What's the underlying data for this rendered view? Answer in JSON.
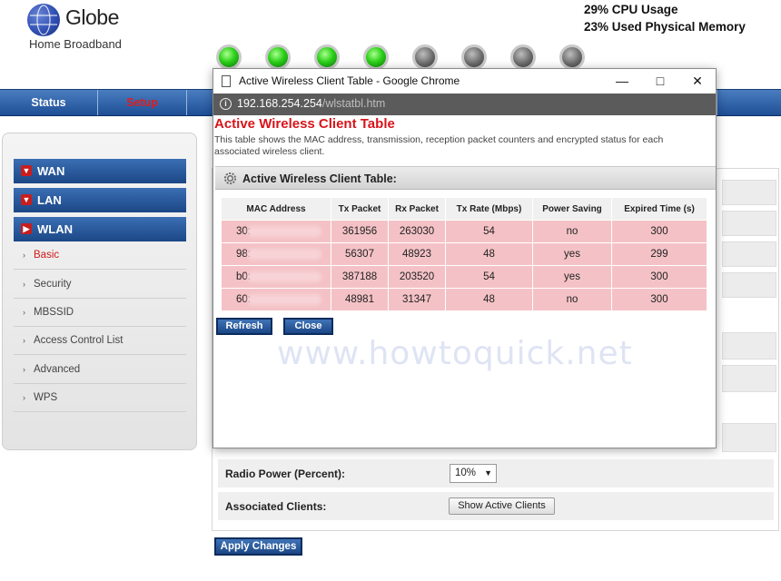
{
  "header": {
    "brand": "Globe",
    "brand_sub": "Home Broadband",
    "cpu_usage": "29% CPU Usage",
    "memory_usage": "23% Used Physical Memory",
    "leds": [
      {
        "state": "on"
      },
      {
        "state": "on"
      },
      {
        "state": "on"
      },
      {
        "state": "on"
      },
      {
        "state": "off"
      },
      {
        "state": "off"
      },
      {
        "state": "off"
      },
      {
        "state": "off"
      }
    ]
  },
  "nav": {
    "tabs": [
      "Status",
      "Setup"
    ],
    "active_tab": "Setup"
  },
  "sidebar": {
    "sections": [
      {
        "label": "WAN"
      },
      {
        "label": "LAN"
      },
      {
        "label": "WLAN"
      }
    ],
    "wlan_items": [
      {
        "label": "Basic",
        "active": true
      },
      {
        "label": "Security"
      },
      {
        "label": "MBSSID"
      },
      {
        "label": "Access Control List"
      },
      {
        "label": "Advanced"
      },
      {
        "label": "WPS"
      }
    ]
  },
  "main": {
    "radio_power_label": "Radio Power (Percent):",
    "radio_power_value": "10%",
    "associated_clients_label": "Associated Clients:",
    "show_clients_button": "Show Active Clients",
    "apply_button": "Apply Changes"
  },
  "popup": {
    "window_title": "Active Wireless Client Table - Google Chrome",
    "url_host": "192.168.254.254",
    "url_path": "/wlstatbl.htm",
    "heading": "Active Wireless Client Table",
    "description": "This table shows the MAC address, transmission, reception packet counters and encrypted status for each associated wireless client.",
    "panel_title": "Active Wireless Client Table:",
    "columns": [
      "MAC Address",
      "Tx Packet",
      "Rx Packet",
      "Tx Rate (Mbps)",
      "Power Saving",
      "Expired Time (s)"
    ],
    "rows": [
      [
        "30:",
        "361956",
        "263030",
        "54",
        "no",
        "300"
      ],
      [
        "98:",
        "56307",
        "48923",
        "48",
        "yes",
        "299"
      ],
      [
        "b0:",
        "387188",
        "203520",
        "54",
        "yes",
        "300"
      ],
      [
        "60:",
        "48981",
        "31347",
        "48",
        "no",
        "300"
      ]
    ],
    "refresh_button": "Refresh",
    "close_button": "Close",
    "watermark": "www.howtoquick.net"
  },
  "colors": {
    "accent_blue": "#1e4f96",
    "heading_red": "#d8141b",
    "row_pink": "#f4c2c6",
    "led_green": "#2ed11a"
  }
}
